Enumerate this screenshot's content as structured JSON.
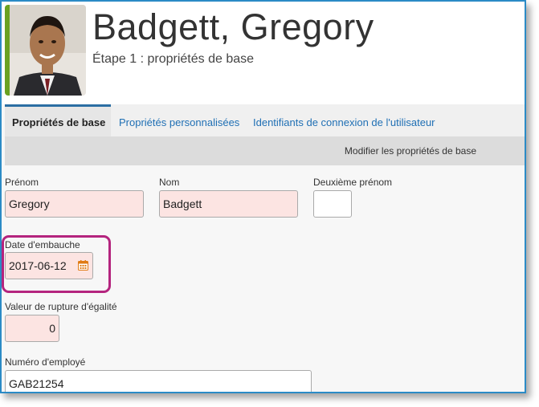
{
  "header": {
    "employee_name": "Badgett, Gregory",
    "subtitle": "Étape 1 : propriétés de base"
  },
  "tabs": [
    {
      "label": "Propriétés de base",
      "active": true
    },
    {
      "label": "Propriétés personnalisées",
      "active": false
    },
    {
      "label": "Identifiants de connexion de l'utilisateur",
      "active": false
    }
  ],
  "toolbar": {
    "edit_label": "Modifier les propriétés de base"
  },
  "form": {
    "first_name": {
      "label": "Prénom",
      "value": "Gregory"
    },
    "last_name": {
      "label": "Nom",
      "value": "Badgett"
    },
    "middle_name": {
      "label": "Deuxième prénom",
      "value": ""
    },
    "hire_date": {
      "label": "Date d'embauche",
      "value": "2017-06-12",
      "icon": "calendar-icon"
    },
    "tiebreaker": {
      "label": "Valeur de rupture d'égalité",
      "value": "0"
    },
    "employee_number": {
      "label": "Numéro d'employé",
      "value": "GAB21254"
    }
  },
  "colors": {
    "accent_border": "#2b8bc6",
    "highlight": "#b4247e",
    "photo_stripe": "#6aa121",
    "required_field_bg": "#fce4e2"
  }
}
